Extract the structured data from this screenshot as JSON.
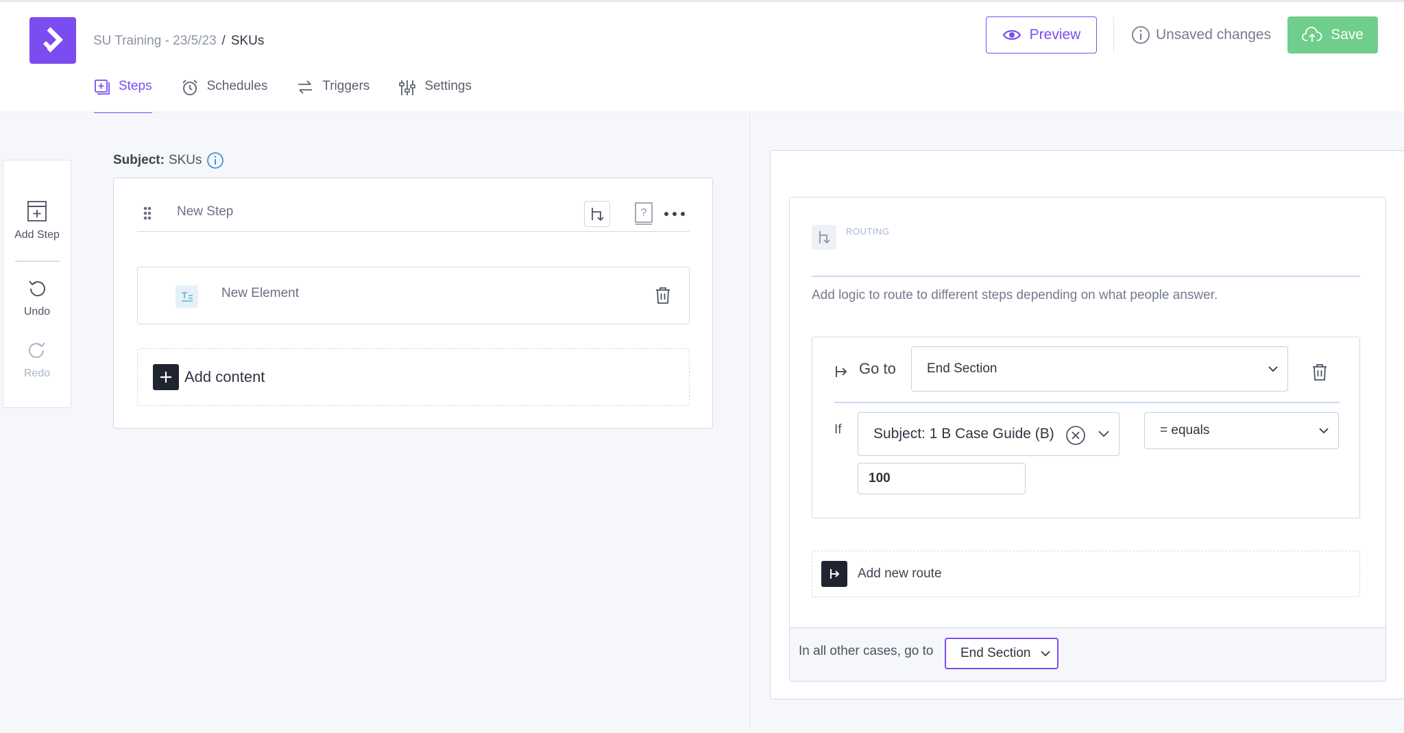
{
  "breadcrumb": {
    "parent": "SU Training - 23/5/23",
    "separator": "/",
    "current": "SKUs"
  },
  "tabs": [
    {
      "label": "Steps",
      "icon": "add-square-icon",
      "active": true
    },
    {
      "label": "Schedules",
      "icon": "alarm-clock-icon",
      "active": false
    },
    {
      "label": "Triggers",
      "icon": "swap-arrows-icon",
      "active": false
    },
    {
      "label": "Settings",
      "icon": "sliders-icon",
      "active": false
    }
  ],
  "header": {
    "preview_label": "Preview",
    "unsaved_label": "Unsaved changes",
    "save_label": "Save"
  },
  "toolbar": {
    "add_step": "Add Step",
    "undo": "Undo",
    "redo": "Redo"
  },
  "subject": {
    "label": "Subject:",
    "value": "SKUs"
  },
  "step": {
    "title": "New Step",
    "element_title": "New Element",
    "add_content": "Add content"
  },
  "routing": {
    "heading": "ROUTING",
    "description": "Add logic to route to different steps depending on what people answer.",
    "route": {
      "goto_label": "Go to",
      "goto_value": "End Section",
      "if_label": "If",
      "condition": "Subject: 1 B Case Guide (B)",
      "operator": "= equals",
      "value": "100"
    },
    "add_route": "Add new route",
    "other_cases_label": "In all other cases, go to",
    "other_cases_value": "End Section"
  },
  "colors": {
    "accent": "#7b4cf0",
    "save": "#6fce8b",
    "border": "#cfdaf0"
  }
}
